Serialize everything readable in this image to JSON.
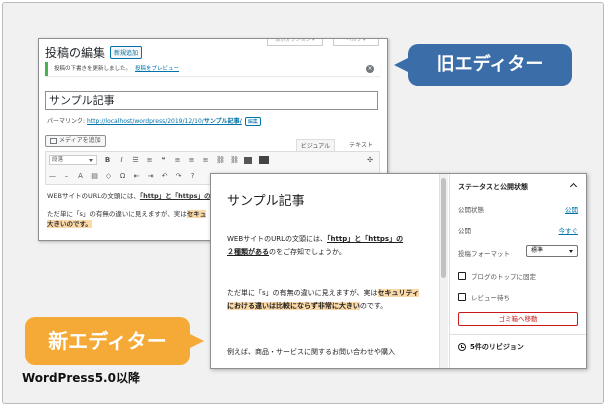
{
  "old_editor": {
    "screen_options": "表示オプション ▾",
    "help": "ヘルプ ▾",
    "page_title": "投稿の編集",
    "add_new": "新規追加",
    "notice_text": "投稿の下書きを更新しました。",
    "notice_link": "投稿をプレビュー",
    "title_value": "サンプル記事",
    "permalink_label": "パーマリンク:",
    "permalink_url": "http://localhost/wordpress/2019/12/10/",
    "permalink_slug": "サンプル記事/",
    "permalink_edit": "編集",
    "add_media": "メディアを追加",
    "tab_visual": "ビジュアル",
    "tab_text": "テキスト",
    "format_select": "段落",
    "body_p1_a": "WEBサイトのURLの文頭には、",
    "body_p1_b": "「http」と「https」の",
    "body_p2_a": "ただ単に「s」の有無の違いに見えますが、実は",
    "body_p2_b": "セキュ",
    "body_p3": "大きいのです。"
  },
  "new_editor": {
    "post_title": "サンプル記事",
    "p1_a": "WEBサイトのURLの文頭には、",
    "p1_b": "「http」と「https」の",
    "p1_c": "２種類がある",
    "p1_d": "のをご存知でしょうか。",
    "p2_a": "ただ単に「s」の有無の違いに見えますが、実は",
    "p2_b": "セキュリティにおける違いは比較にならず非常に大きい",
    "p2_c": "のです。",
    "p3": "例えば、商品・サービスに関するお問い合わせや購入",
    "sidebar": {
      "panel_title": "ステータスと公開状態",
      "visibility_label": "公開状態",
      "visibility_value": "公開",
      "publish_label": "公開",
      "publish_value": "今すぐ",
      "format_label": "投稿フォーマット",
      "format_value": "標準",
      "stick_label": "ブログのトップに固定",
      "pending_label": "レビュー待ち",
      "trash_button": "ゴミ箱へ移動",
      "revisions": "5件のリビジョン"
    }
  },
  "callouts": {
    "old_label": "旧エディター",
    "new_label": "新エディター",
    "version_note": "WordPress5.0以降"
  },
  "colors": {
    "old_callout": "#3b6da8",
    "new_callout": "#f5a937",
    "highlight": "#fcd9a8",
    "link": "#0073aa",
    "danger": "#cc1818"
  }
}
